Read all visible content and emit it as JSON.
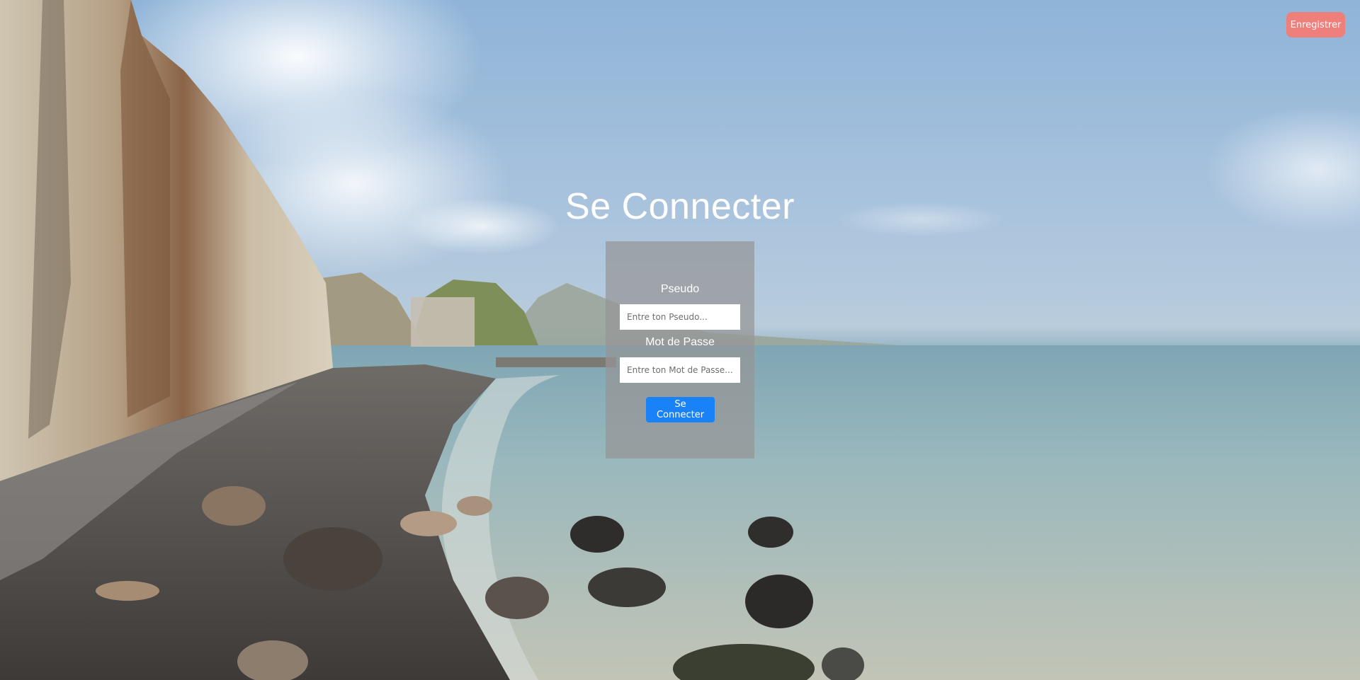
{
  "header": {
    "register_label": "Enregistrer"
  },
  "login": {
    "title": "Se Connecter",
    "username_label": "Pseudo",
    "username_placeholder": "Entre ton Pseudo...",
    "username_value": "",
    "password_label": "Mot de Passe",
    "password_placeholder": "Entre ton Mot de Passe...",
    "password_value": "",
    "submit_label": "Se Connecter"
  },
  "colors": {
    "register_button": "#ee7f7a",
    "submit_button": "#1a82f7",
    "panel_background": "rgba(150,150,150,0.72)",
    "text": "#ffffff"
  }
}
